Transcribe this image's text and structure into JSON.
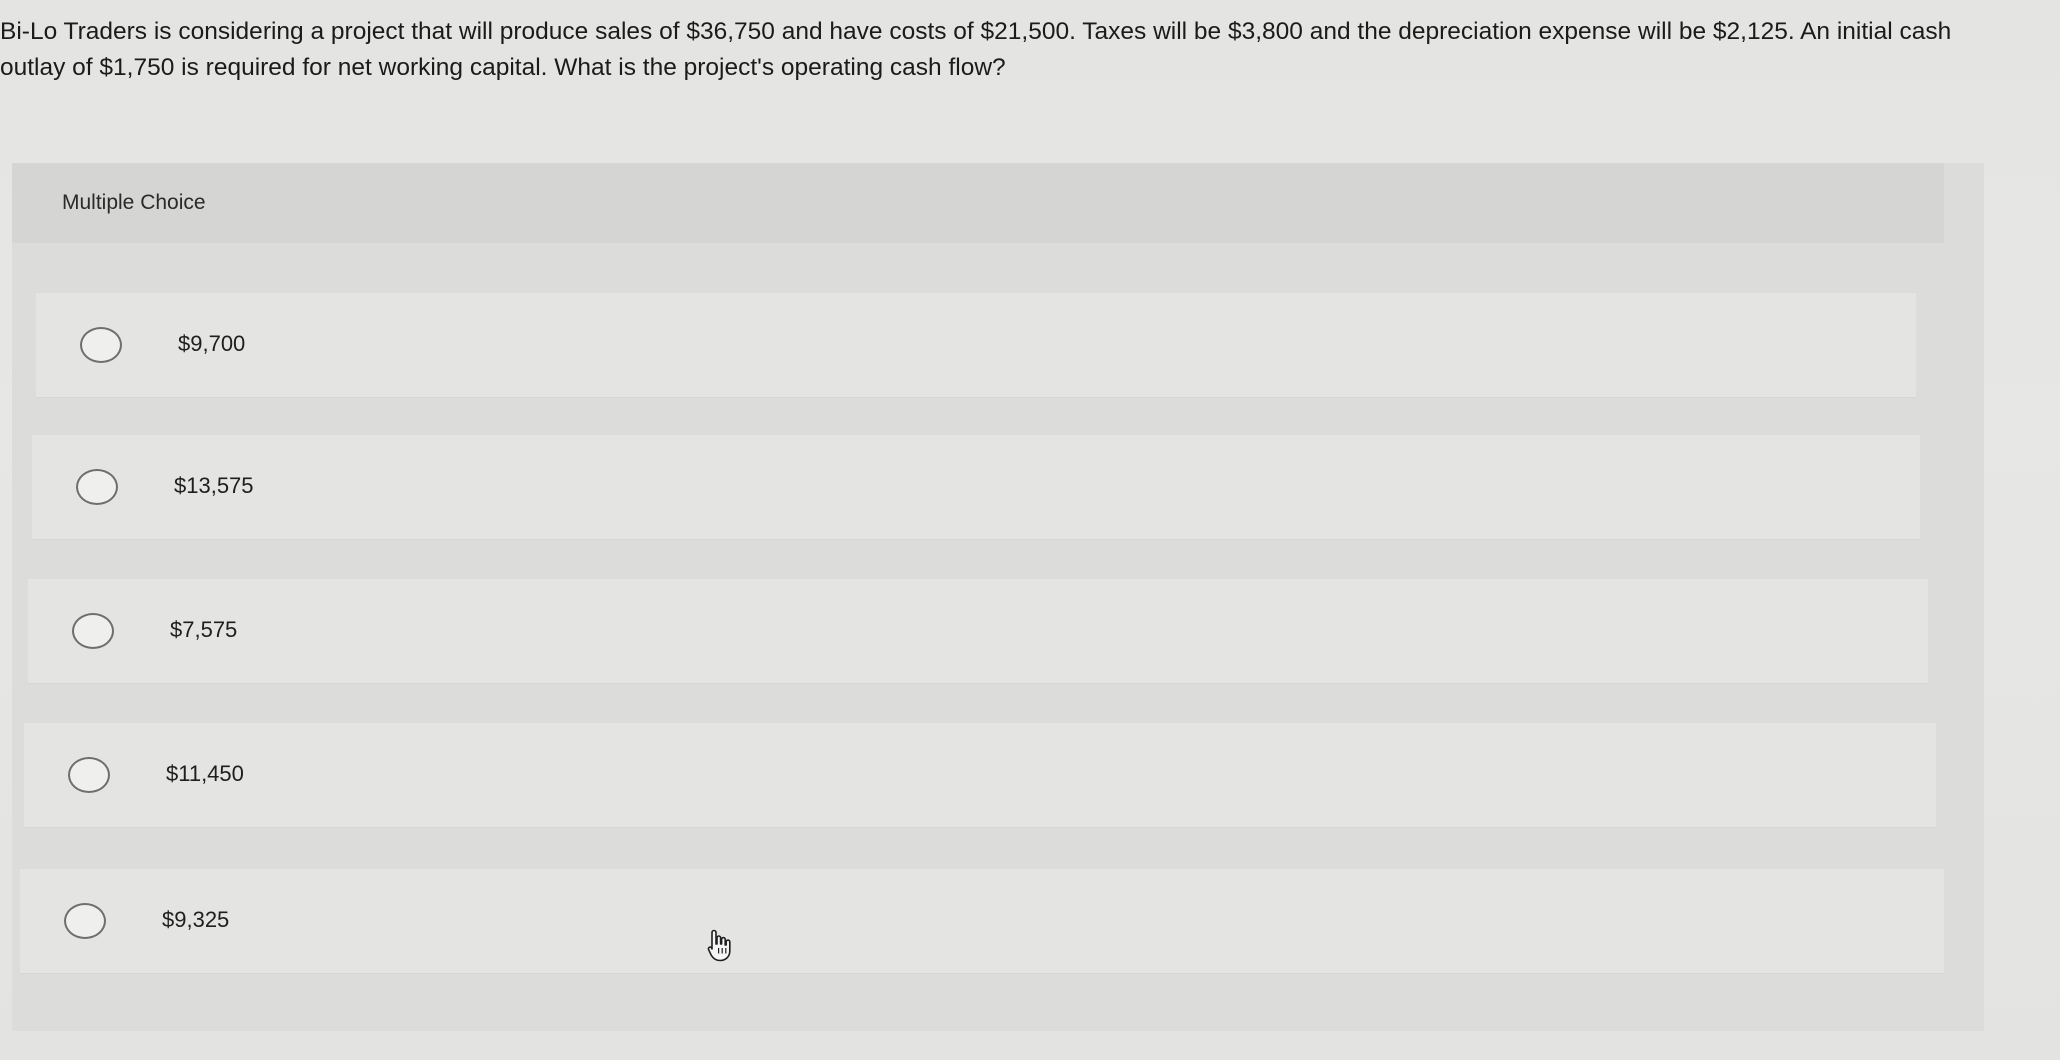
{
  "question": {
    "text": "Bi-Lo Traders is considering a project that will produce sales of $36,750 and have costs of $21,500. Taxes will be $3,800 and the depreciation expense will be $2,125. An initial cash outlay of $1,750 is required for net working capital. What is the project's operating cash flow?"
  },
  "multiple_choice": {
    "title": "Multiple Choice",
    "options": [
      {
        "label": "$9,700"
      },
      {
        "label": "$13,575"
      },
      {
        "label": "$7,575"
      },
      {
        "label": "$11,450"
      },
      {
        "label": "$9,325"
      }
    ]
  },
  "icons": {
    "cursor": "hand-pointer-icon",
    "radio": "radio-unselected-icon"
  }
}
